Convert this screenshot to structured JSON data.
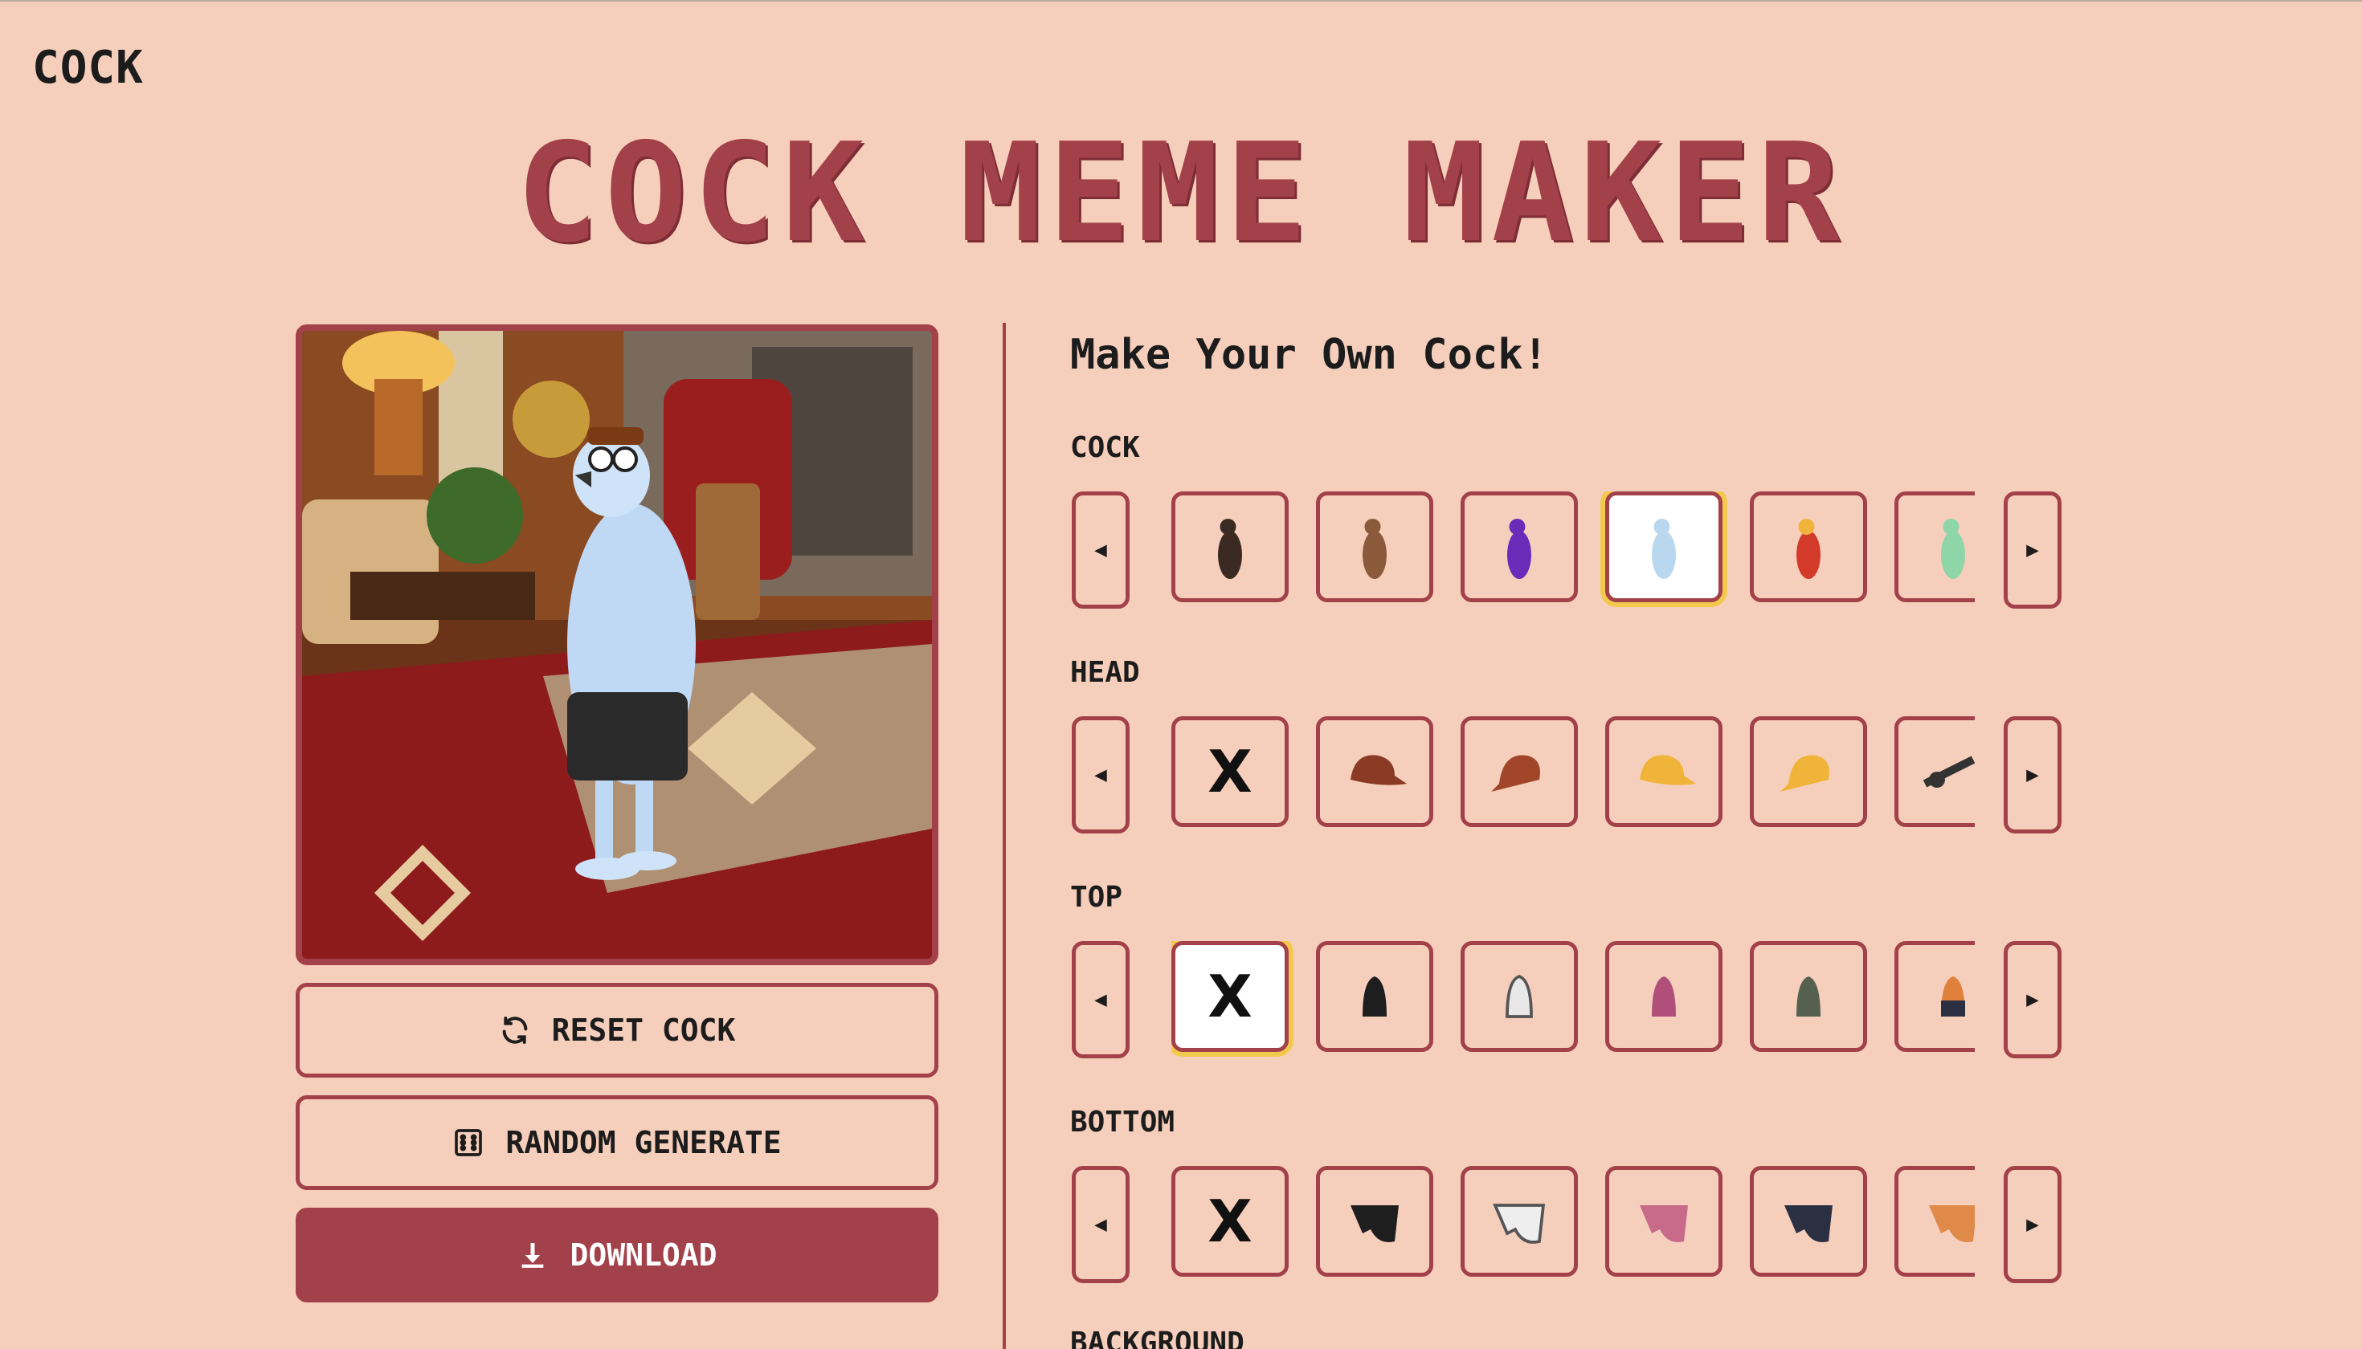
{
  "brand": "COCK",
  "title": "COCK MEME MAKER",
  "subtitle": "Make Your Own Cock!",
  "buttons": {
    "reset": "RESET COCK",
    "random": "RANDOM GENERATE",
    "download": "DOWNLOAD"
  },
  "arrows": {
    "prev": "◀",
    "next": "▶"
  },
  "sections": {
    "cock": {
      "label": "COCK",
      "items": [
        {
          "icon": "dark-rooster-icon",
          "color": "#3b2a22"
        },
        {
          "icon": "brown-rooster-icon",
          "color": "#8a5a3a"
        },
        {
          "icon": "purple-rooster-icon",
          "color": "#6a2bb8"
        },
        {
          "icon": "ice-rooster-icon",
          "color": "#b9d8ef",
          "selected": true
        },
        {
          "icon": "fire-rooster-icon",
          "color": "#d33a2a"
        },
        {
          "icon": "green-rooster-icon",
          "color": "#8ed6a8"
        }
      ]
    },
    "head": {
      "label": "HEAD",
      "none_label": "X",
      "items": [
        {
          "icon": "none-icon"
        },
        {
          "icon": "brown-cap-icon",
          "color": "#8b3a24"
        },
        {
          "icon": "brown-cap-icon",
          "color": "#a2462a"
        },
        {
          "icon": "yellow-cap-icon",
          "color": "#f0b43a"
        },
        {
          "icon": "yellow-cap-icon",
          "color": "#f0b43a"
        },
        {
          "icon": "sunglasses-icon",
          "color": "#333333"
        }
      ]
    },
    "top": {
      "label": "TOP",
      "none_label": "X",
      "items": [
        {
          "icon": "none-icon",
          "selected": true
        },
        {
          "icon": "black-hoodie-icon",
          "color": "#1e1e1e"
        },
        {
          "icon": "white-hoodie-icon",
          "color": "#e8e8e8"
        },
        {
          "icon": "pink-hoodie-icon",
          "color": "#b0507a"
        },
        {
          "icon": "grey-hoodie-icon",
          "color": "#55604f"
        },
        {
          "icon": "orange-jacket-icon",
          "color": "#e0803a"
        }
      ]
    },
    "bottom": {
      "label": "BOTTOM",
      "none_label": "X",
      "items": [
        {
          "icon": "none-icon"
        },
        {
          "icon": "black-shorts-icon",
          "color": "#1e1e1e"
        },
        {
          "icon": "white-shorts-icon",
          "color": "#eeeeee"
        },
        {
          "icon": "pink-shorts-icon",
          "color": "#c86a8a"
        },
        {
          "icon": "navy-shorts-icon",
          "color": "#2a2f42"
        },
        {
          "icon": "orange-shorts-icon",
          "color": "#e08a4a"
        }
      ]
    },
    "background": {
      "label": "BACKGROUND"
    }
  },
  "colors": {
    "accent": "#a3414a",
    "page_bg": "#f6cfbc",
    "highlight": "#f2c94c"
  }
}
